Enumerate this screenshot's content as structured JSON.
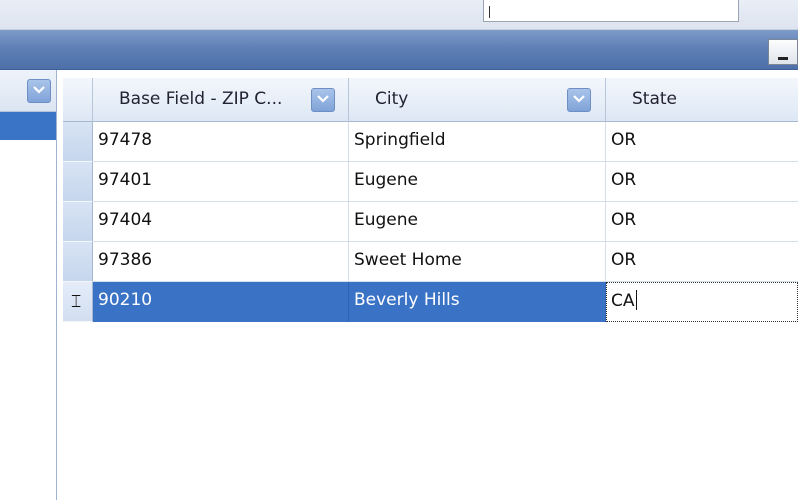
{
  "grid": {
    "columns": [
      {
        "label": "Base Field - ZIP C..."
      },
      {
        "label": "City"
      },
      {
        "label": "State"
      }
    ],
    "rows": [
      {
        "zip": "97478",
        "city": "Springfield",
        "state": "OR"
      },
      {
        "zip": "97401",
        "city": "Eugene",
        "state": "OR"
      },
      {
        "zip": "97404",
        "city": "Eugene",
        "state": "OR"
      },
      {
        "zip": "97386",
        "city": "Sweet Home",
        "state": "OR"
      },
      {
        "zip": "90210",
        "city": "Beverly Hills",
        "state": "CA"
      }
    ],
    "selected_row_index": 4,
    "editing_column": "state"
  },
  "icons": {
    "column_dropdown": "chevron-down-icon",
    "row_edit_indicator": "i-beam-cursor-icon",
    "minimize": "minimize-icon"
  },
  "colors": {
    "title_band": "#5f80b6",
    "selection": "#3a72c6",
    "dropdown_button": "#8fb0e0"
  }
}
